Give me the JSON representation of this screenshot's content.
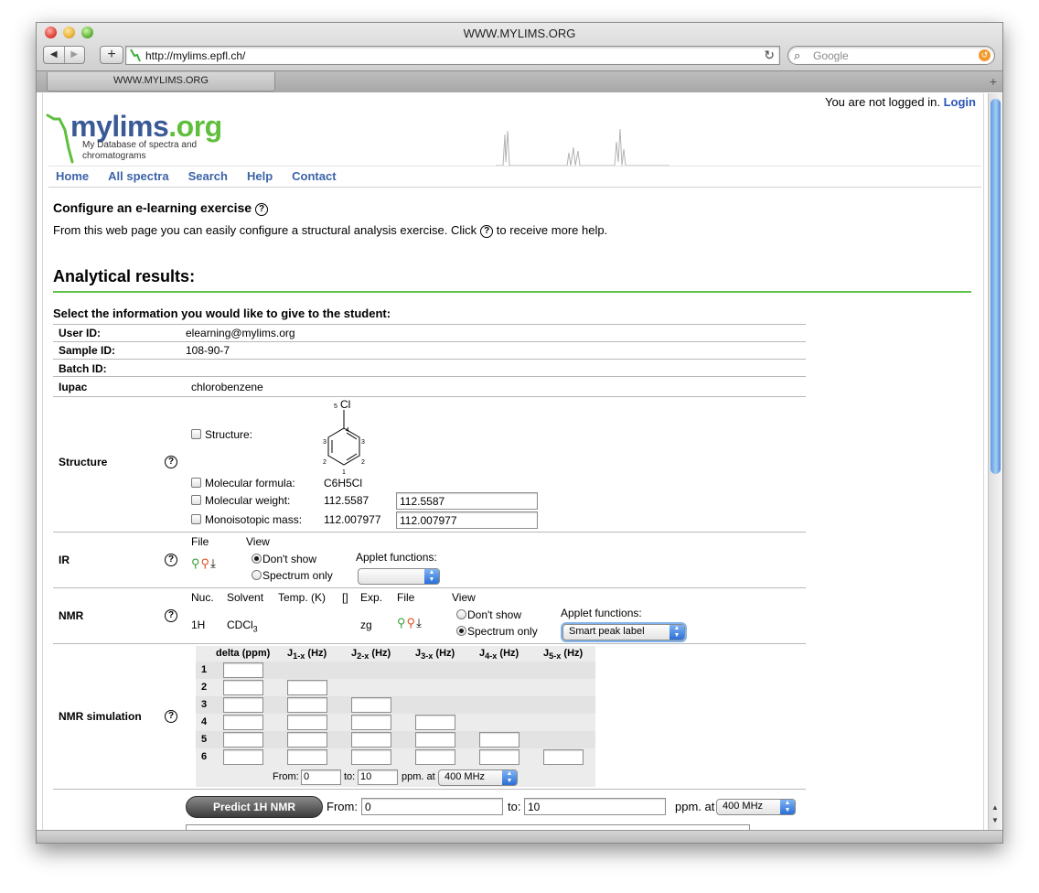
{
  "browser": {
    "window_title": "WWW.MYLIMS.ORG",
    "url": "http://mylims.epfl.ch/",
    "search_placeholder": "Google",
    "tab_title": "WWW.MYLIMS.ORG"
  },
  "header": {
    "login_status": "You are not logged in.",
    "login_link": "Login",
    "logo_text": "mylims",
    "logo_suffix": ".org",
    "tagline": "My Database of spectra and chromatograms"
  },
  "nav": {
    "items": [
      "Home",
      "All spectra",
      "Search",
      "Help",
      "Contact"
    ]
  },
  "page": {
    "config_title": "Configure an e-learning exercise",
    "config_desc_before": "From this web page you can easily configure a structural analysis exercise. Click",
    "config_desc_after": "to receive more help.",
    "section_title": "Analytical results:",
    "select_title": "Select the information you would like to give to the student:",
    "help_glyph": "?"
  },
  "info": {
    "user_id_label": "User ID:",
    "user_id": "elearning@mylims.org",
    "sample_id_label": "Sample ID:",
    "sample_id": "108-90-7",
    "batch_id_label": "Batch ID:",
    "batch_id": "",
    "iupac_label": "Iupac",
    "iupac": "chlorobenzene"
  },
  "structure": {
    "label": "Structure",
    "structure_cb": "Structure:",
    "atom_cl": "Cl",
    "atom_numbers": [
      "5",
      "4",
      "3",
      "3",
      "2",
      "2",
      "1"
    ],
    "formula_cb": "Molecular formula:",
    "formula": "C6H5Cl",
    "weight_cb": "Molecular weight:",
    "weight": "112.5587",
    "weight_input": "112.5587",
    "mono_cb": "Monoisotopic mass:",
    "mono": "112.007977",
    "mono_input": "112.007977"
  },
  "ir": {
    "label": "IR",
    "file_header": "File",
    "view_header": "View",
    "view_opt1": "Don't show",
    "view_opt2": "Spectrum only",
    "applet_label": "Applet functions:",
    "applet_value": ""
  },
  "nmr": {
    "label": "NMR",
    "headers": [
      "Nuc.",
      "Solvent",
      "Temp. (K)",
      "[]",
      "Exp.",
      "File",
      "View"
    ],
    "nuc": "1H",
    "solvent_base": "CDCl",
    "solvent_sub": "3",
    "exp": "zg",
    "view_opt1": "Don't show",
    "view_opt2": "Spectrum only",
    "applet_label": "Applet functions:",
    "applet_value": "Smart peak label"
  },
  "nmr_sim": {
    "label": "NMR simulation",
    "col_delta": "delta (ppm)",
    "col_j1": "J",
    "col_j1_sub": "1-x",
    "col_j2": "J",
    "col_j2_sub": "2-x",
    "col_j3": "J",
    "col_j3_sub": "3-x",
    "col_j4": "J",
    "col_j4_sub": "4-x",
    "col_j5": "J",
    "col_j5_sub": "5-x",
    "hz": "(Hz)",
    "rows": [
      "1",
      "2",
      "3",
      "4",
      "5",
      "6"
    ],
    "from_label": "From:",
    "from_value": "0",
    "to_label": "to:",
    "to_value": "10",
    "ppm_label": "ppm. at",
    "freq": "400 MHz"
  },
  "predict": {
    "button": "Predict 1H NMR",
    "from_label": "From:",
    "from_value": "0",
    "to_label": "to:",
    "to_value": "10",
    "ppm_label": "ppm. at",
    "freq": "400 MHz"
  },
  "colors": {
    "link_blue": "#3b63a8",
    "green_rule": "#5fc24a",
    "logo_blue": "#3a5a96"
  }
}
